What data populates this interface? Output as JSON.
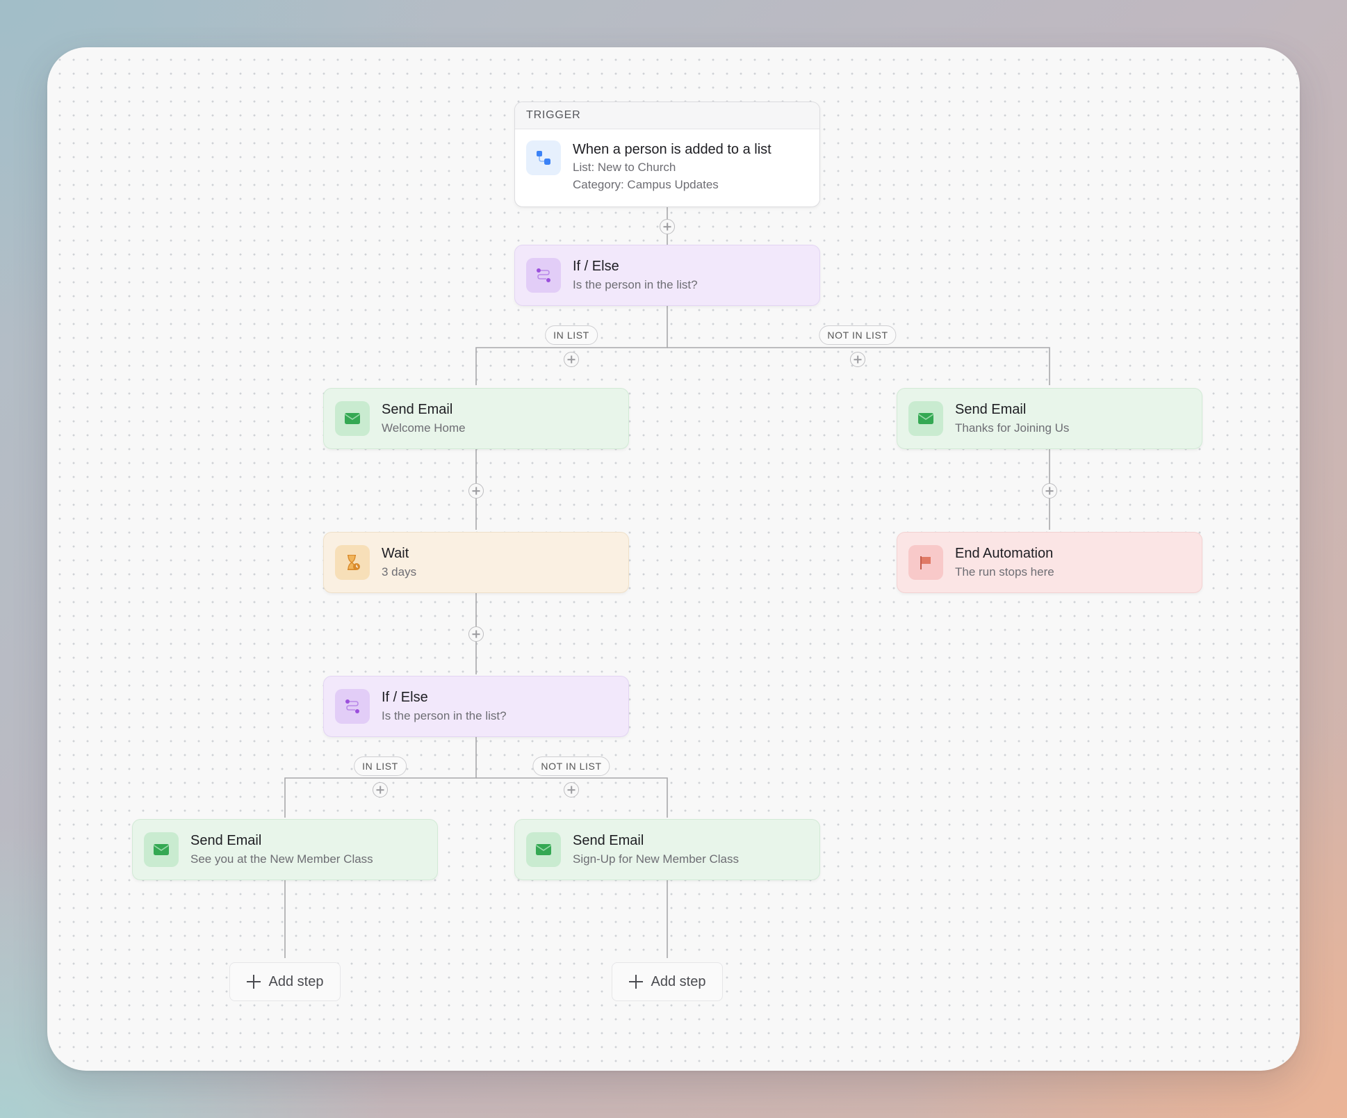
{
  "trigger": {
    "header": "TRIGGER",
    "title": "When a person is added to a list",
    "list": "List: New to Church",
    "category": "Category: Campus Updates",
    "icon": "list-trigger-icon"
  },
  "ifelse_1": {
    "title": "If / Else",
    "subtitle": "Is the person in the list?",
    "icon": "branch-icon"
  },
  "branch_labels_1": {
    "in": "IN LIST",
    "not_in": "NOT IN LIST"
  },
  "email_welcome": {
    "title": "Send Email",
    "subtitle": "Welcome Home",
    "icon": "envelope-icon"
  },
  "email_thanks": {
    "title": "Send Email",
    "subtitle": "Thanks for Joining Us",
    "icon": "envelope-icon"
  },
  "wait": {
    "title": "Wait",
    "subtitle": "3 days",
    "icon": "hourglass-icon"
  },
  "end": {
    "title": "End Automation",
    "subtitle": "The run stops here",
    "icon": "flag-icon"
  },
  "ifelse_2": {
    "title": "If / Else",
    "subtitle": "Is the person in the list?",
    "icon": "branch-icon"
  },
  "branch_labels_2": {
    "in": "IN LIST",
    "not_in": "NOT IN LIST"
  },
  "email_see_you": {
    "title": "Send Email",
    "subtitle": "See you at the New Member Class",
    "icon": "envelope-icon"
  },
  "email_signup": {
    "title": "Send Email",
    "subtitle": "Sign-Up for New Member Class",
    "icon": "envelope-icon"
  },
  "add_step_label": "Add step",
  "colors": {
    "email": "#e8f5ea",
    "condition": "#f2e8fb",
    "wait": "#faf0e2",
    "end": "#fbe5e5",
    "trigger_icon": "#3b82f6"
  }
}
